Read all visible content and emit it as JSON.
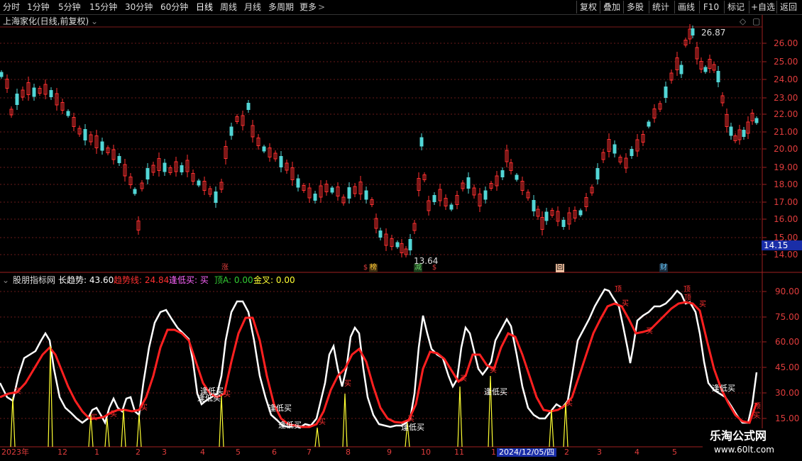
{
  "toolbar": {
    "periods": [
      "分时",
      "1分钟",
      "5分钟",
      "15分钟",
      "30分钟",
      "60分钟",
      "日线",
      "周线",
      "月线",
      "多周期",
      "更多"
    ],
    "more_arrow": ">",
    "active": "日线",
    "right_buttons": [
      "复权",
      "叠加",
      "多股",
      "统计",
      "画线",
      "F10",
      "标记",
      "+自选",
      "返回"
    ]
  },
  "main_chart": {
    "title": "上海家化(日线,前复权)",
    "high_label": "26.87",
    "low_label": "13.64",
    "current_price": "14.15",
    "price_ticks": [
      "26.00",
      "25.00",
      "24.00",
      "23.00",
      "22.00",
      "21.00",
      "20.00",
      "19.00",
      "18.00",
      "17.00",
      "16.00",
      "15.00",
      "14.00"
    ],
    "events": [
      {
        "text": "涨",
        "color": "#e03c3c",
        "bg": "#3a1a1a"
      },
      {
        "text": "$",
        "color": "#e03c3c",
        "bg": ""
      },
      {
        "text": "榜",
        "color": "#ffcc33",
        "bg": "#3a2a10"
      },
      {
        "text": "减",
        "color": "#66cc66",
        "bg": "#1a3a1a"
      },
      {
        "text": "$",
        "color": "#e03c3c",
        "bg": ""
      },
      {
        "text": "回",
        "color": "#000000",
        "bg": "#f0c0a0"
      },
      {
        "text": "财",
        "color": "#66ccff",
        "bg": "#1a2a3a"
      }
    ]
  },
  "indicator": {
    "name": "股朋指标网",
    "fields": [
      {
        "label": "长趋势:",
        "value": "43.60",
        "color": "#ffffff"
      },
      {
        "label": "趋势线:",
        "value": "24.84",
        "color": "#ff3030"
      },
      {
        "label": "逢低买:",
        "value": "买",
        "color": "#ff66ff"
      },
      {
        "label": "顶A:",
        "value": "0.00",
        "color": "#33cc33"
      },
      {
        "label": "金叉:",
        "value": "0.00",
        "color": "#ffff33"
      }
    ],
    "ticks": [
      "90.00",
      "75.00",
      "60.00",
      "45.00",
      "30.00",
      "15.00"
    ],
    "annotations": [
      "逢低买",
      "逢低买",
      "逢低买",
      "逢低买",
      "逢低买",
      "逢低买",
      "逢低买"
    ],
    "buy_marks": [
      "买",
      "买",
      "买",
      "买",
      "买",
      "买",
      "买",
      "买",
      "买",
      "买",
      "买",
      "买",
      "买",
      "买",
      "买"
    ],
    "top_marks": [
      "顶",
      "顶",
      "顶",
      "顶"
    ]
  },
  "time_axis": {
    "labels": [
      "2023年",
      "12",
      "1",
      "2",
      "3",
      "4",
      "5",
      "6",
      "7",
      "8",
      "9",
      "10",
      "11",
      "1",
      "2",
      "3",
      "4",
      "5"
    ],
    "cursor_date": "2024/12/05/四"
  },
  "watermark": {
    "line1": "乐淘公式网",
    "line2": "www.60lt.com"
  }
}
